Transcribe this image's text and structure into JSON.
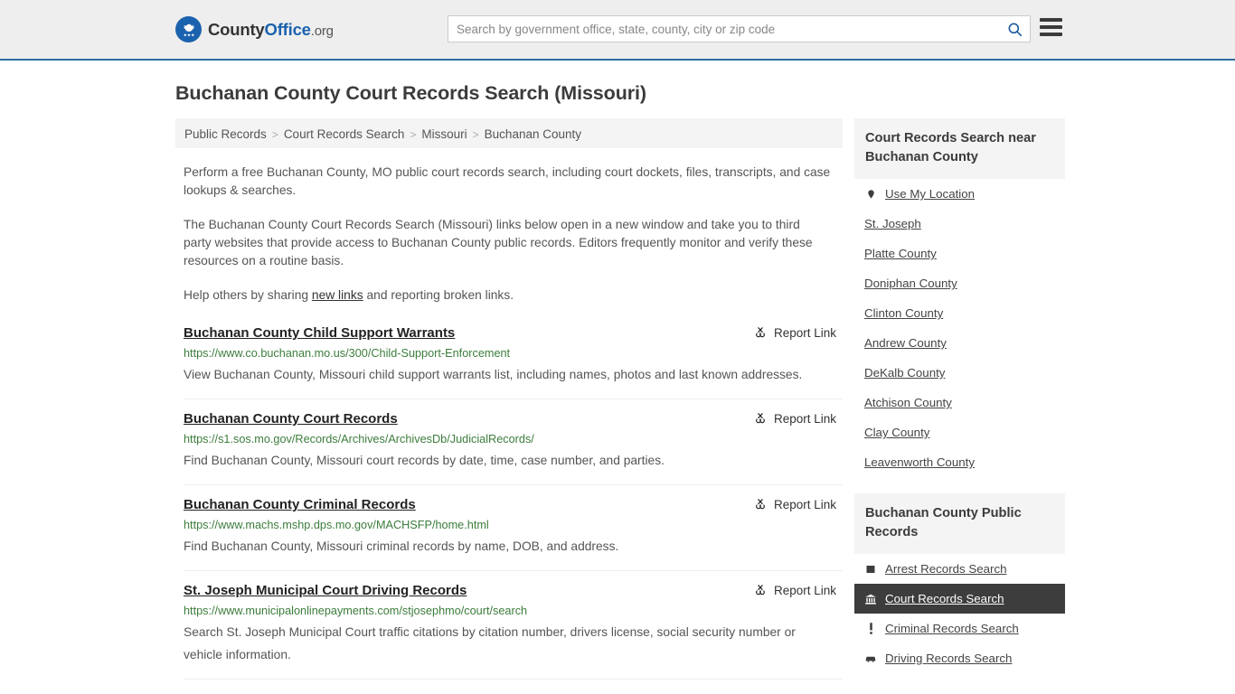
{
  "header": {
    "brand": {
      "part1": "County",
      "part2": "Office",
      "suffix": ".org"
    },
    "search": {
      "placeholder": "Search by government office, state, county, city or zip code",
      "value": ""
    },
    "search_icon": "search-icon",
    "menu_icon": "hamburger-menu-icon",
    "accent_color": "#1b62ae",
    "background_color": "#eeeeee"
  },
  "page_title": "Buchanan County Court Records Search (Missouri)",
  "breadcrumb": [
    "Public Records",
    "Court Records Search",
    "Missouri",
    "Buchanan County"
  ],
  "breadcrumb_separator": ">",
  "intro": {
    "p1": "Perform a free Buchanan County, MO public court records search, including court dockets, files, transcripts, and case lookups & searches.",
    "p2": "The Buchanan County Court Records Search (Missouri) links below open in a new window and take you to third party websites that provide access to Buchanan County public records. Editors frequently monitor and verify these resources on a routine basis.",
    "p3_before": "Help others by sharing ",
    "p3_link": "new links",
    "p3_after": " and reporting broken links."
  },
  "report_link_label": "Report Link",
  "report_link_icon": "broken-link-icon",
  "results": [
    {
      "title": "Buchanan County Child Support Warrants",
      "url": "https://www.co.buchanan.mo.us/300/Child-Support-Enforcement",
      "description": "View Buchanan County, Missouri child support warrants list, including names, photos and last known addresses."
    },
    {
      "title": "Buchanan County Court Records",
      "url": "https://s1.sos.mo.gov/Records/Archives/ArchivesDb/JudicialRecords/",
      "description": "Find Buchanan County, Missouri court records by date, time, case number, and parties."
    },
    {
      "title": "Buchanan County Criminal Records",
      "url": "https://www.machs.mshp.dps.mo.gov/MACHSFP/home.html",
      "description": "Find Buchanan County, Missouri criminal records by name, DOB, and address."
    },
    {
      "title": "St. Joseph Municipal Court Driving Records",
      "url": "https://www.municipalonlinepayments.com/stjosephmo/court/search",
      "description": "Search St. Joseph Municipal Court traffic citations by citation number, drivers license, social security number or vehicle information."
    }
  ],
  "sidebar": {
    "nearby": {
      "heading": "Court Records Search near Buchanan County",
      "items": [
        {
          "label": "Use My Location",
          "icon": "map-pin-icon"
        },
        {
          "label": "St. Joseph",
          "icon": ""
        },
        {
          "label": "Platte County",
          "icon": ""
        },
        {
          "label": "Doniphan County",
          "icon": ""
        },
        {
          "label": "Clinton County",
          "icon": ""
        },
        {
          "label": "Andrew County",
          "icon": ""
        },
        {
          "label": "DeKalb County",
          "icon": ""
        },
        {
          "label": "Atchison County",
          "icon": ""
        },
        {
          "label": "Clay County",
          "icon": ""
        },
        {
          "label": "Leavenworth County",
          "icon": ""
        }
      ]
    },
    "public_records": {
      "heading": "Buchanan County Public Records",
      "items": [
        {
          "label": "Arrest Records Search",
          "icon": "square-icon",
          "active": false
        },
        {
          "label": "Court Records Search",
          "icon": "courthouse-icon",
          "active": true
        },
        {
          "label": "Criminal Records Search",
          "icon": "exclamation-icon",
          "active": false
        },
        {
          "label": "Driving Records Search",
          "icon": "car-icon",
          "active": false
        }
      ],
      "active_background": "#3d3d3d"
    }
  }
}
